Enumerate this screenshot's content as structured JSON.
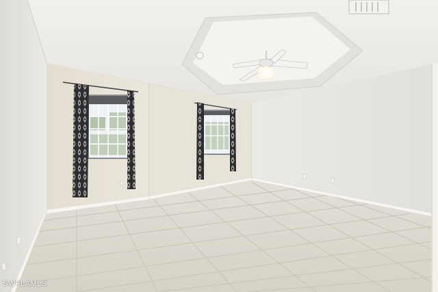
{
  "watermark": {
    "text": "SWFLAMLS"
  },
  "colors": {
    "ceiling": "#ecebe7",
    "wall_left": "#e8e6e1",
    "wall_back": "#e6e1d6",
    "wall_right": "#e7e6e2",
    "floor": "#dcd8ce",
    "grout": "#c9c4b9",
    "baseboard": "#f7f6f2",
    "curtain_dark": "#2a2a2d",
    "window_light": "#eef2f4"
  }
}
